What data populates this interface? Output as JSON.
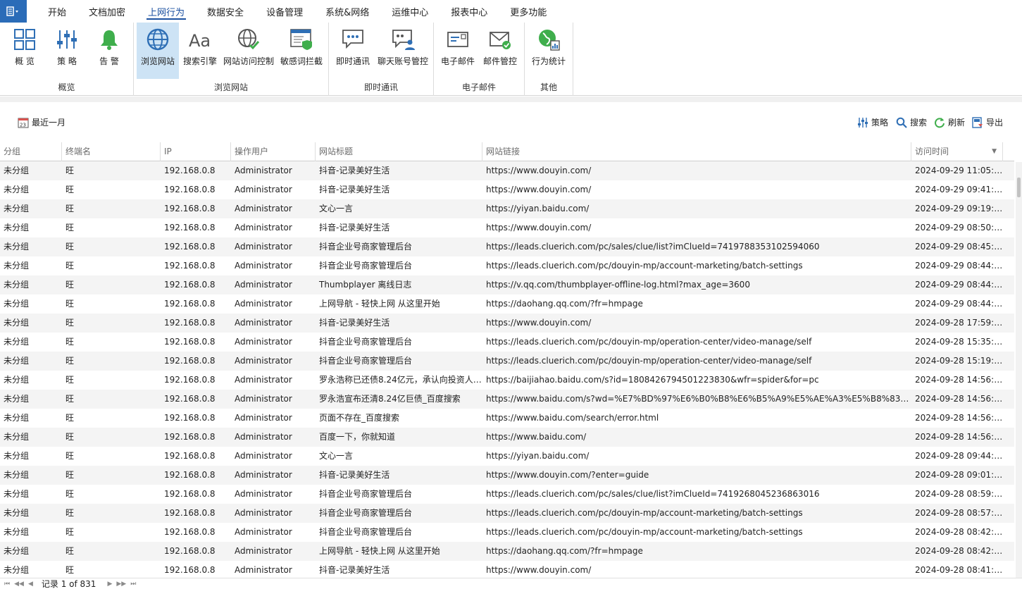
{
  "menu": {
    "tabs": [
      "开始",
      "文档加密",
      "上网行为",
      "数据安全",
      "设备管理",
      "系统&网络",
      "运维中心",
      "报表中心",
      "更多功能"
    ],
    "active_index": 2
  },
  "ribbon": {
    "groups": {
      "overview": "概览",
      "browse": "浏览网站",
      "im": "即时通讯",
      "email": "电子邮件",
      "other": "其他"
    },
    "buttons": {
      "overview": "概 览",
      "policy": "策 略",
      "alert": "告 警",
      "browse_web": "浏览网站",
      "search_engine": "搜索引擎",
      "site_access": "网站访问控制",
      "sensitive_words": "敏感词拦截",
      "im": "即时通讯",
      "chat_accounts": "聊天账号管控",
      "email": "电子邮件",
      "email_control": "邮件管控",
      "stats": "行为统计"
    }
  },
  "toolbar": {
    "date_filter": "最近一月",
    "date_icon_text": "23",
    "policy": "策略",
    "search": "搜索",
    "refresh": "刷新",
    "export": "导出"
  },
  "table": {
    "columns": [
      "分组",
      "终端名",
      "IP",
      "操作用户",
      "网站标题",
      "网站链接",
      "访问时间"
    ],
    "sort_indicator": "▼",
    "rows": [
      [
        "未分组",
        "旺",
        "192.168.0.8",
        "Administrator",
        "抖音-记录美好生活",
        "https://www.douyin.com/",
        "2024-09-29 11:05:55"
      ],
      [
        "未分组",
        "旺",
        "192.168.0.8",
        "Administrator",
        "抖音-记录美好生活",
        "https://www.douyin.com/",
        "2024-09-29 09:41:09"
      ],
      [
        "未分组",
        "旺",
        "192.168.0.8",
        "Administrator",
        "文心一言",
        "https://yiyan.baidu.com/",
        "2024-09-29 09:19:07"
      ],
      [
        "未分组",
        "旺",
        "192.168.0.8",
        "Administrator",
        "抖音-记录美好生活",
        "https://www.douyin.com/",
        "2024-09-29 08:50:47"
      ],
      [
        "未分组",
        "旺",
        "192.168.0.8",
        "Administrator",
        "抖音企业号商家管理后台",
        "https://leads.cluerich.com/pc/sales/clue/list?imClueId=7419788353102594060",
        "2024-09-29 08:45:02"
      ],
      [
        "未分组",
        "旺",
        "192.168.0.8",
        "Administrator",
        "抖音企业号商家管理后台",
        "https://leads.cluerich.com/pc/douyin-mp/account-marketing/batch-settings",
        "2024-09-29 08:44:47"
      ],
      [
        "未分组",
        "旺",
        "192.168.0.8",
        "Administrator",
        "Thumbplayer 离线日志",
        "https://v.qq.com/thumbplayer-offline-log.html?max_age=3600",
        "2024-09-29 08:44:42"
      ],
      [
        "未分组",
        "旺",
        "192.168.0.8",
        "Administrator",
        "上网导航 - 轻快上网 从这里开始",
        "https://daohang.qq.com/?fr=hmpage",
        "2024-09-29 08:44:39"
      ],
      [
        "未分组",
        "旺",
        "192.168.0.8",
        "Administrator",
        "抖音-记录美好生活",
        "https://www.douyin.com/",
        "2024-09-28 17:59:28"
      ],
      [
        "未分组",
        "旺",
        "192.168.0.8",
        "Administrator",
        "抖音企业号商家管理后台",
        "https://leads.cluerich.com/pc/douyin-mp/operation-center/video-manage/self",
        "2024-09-28 15:35:09"
      ],
      [
        "未分组",
        "旺",
        "192.168.0.8",
        "Administrator",
        "抖音企业号商家管理后台",
        "https://leads.cluerich.com/pc/douyin-mp/operation-center/video-manage/self",
        "2024-09-28 15:19:15"
      ],
      [
        "未分组",
        "旺",
        "192.168.0.8",
        "Administrator",
        "罗永浩称已还债8.24亿元，承认向投资人…",
        "https://baijiahao.baidu.com/s?id=1808426794501223830&wfr=spider&for=pc",
        "2024-09-28 14:56:33"
      ],
      [
        "未分组",
        "旺",
        "192.168.0.8",
        "Administrator",
        "罗永浩宣布还清8.24亿巨债_百度搜索",
        "https://www.baidu.com/s?wd=%E7%BD%97%E6%B0%B8%E6%B5%A9%E5%AE%A3%E5%B8%83%E8…",
        "2024-09-28 14:56:13"
      ],
      [
        "未分组",
        "旺",
        "192.168.0.8",
        "Administrator",
        "页面不存在_百度搜索",
        "https://www.baidu.com/search/error.html",
        "2024-09-28 14:56:10"
      ],
      [
        "未分组",
        "旺",
        "192.168.0.8",
        "Administrator",
        "百度一下，你就知道",
        "https://www.baidu.com/",
        "2024-09-28 14:56:09"
      ],
      [
        "未分组",
        "旺",
        "192.168.0.8",
        "Administrator",
        "文心一言",
        "https://yiyan.baidu.com/",
        "2024-09-28 09:44:42"
      ],
      [
        "未分组",
        "旺",
        "192.168.0.8",
        "Administrator",
        "抖音-记录美好生活",
        "https://www.douyin.com/?enter=guide",
        "2024-09-28 09:01:45"
      ],
      [
        "未分组",
        "旺",
        "192.168.0.8",
        "Administrator",
        "抖音企业号商家管理后台",
        "https://leads.cluerich.com/pc/sales/clue/list?imClueId=7419268045236863016",
        "2024-09-28 08:59:15"
      ],
      [
        "未分组",
        "旺",
        "192.168.0.8",
        "Administrator",
        "抖音企业号商家管理后台",
        "https://leads.cluerich.com/pc/douyin-mp/account-marketing/batch-settings",
        "2024-09-28 08:57:05"
      ],
      [
        "未分组",
        "旺",
        "192.168.0.8",
        "Administrator",
        "抖音企业号商家管理后台",
        "https://leads.cluerich.com/pc/douyin-mp/account-marketing/batch-settings",
        "2024-09-28 08:42:15"
      ],
      [
        "未分组",
        "旺",
        "192.168.0.8",
        "Administrator",
        "上网导航 - 轻快上网 从这里开始",
        "https://daohang.qq.com/?fr=hmpage",
        "2024-09-28 08:42:14"
      ],
      [
        "未分组",
        "旺",
        "192.168.0.8",
        "Administrator",
        "抖音-记录美好生活",
        "https://www.douyin.com/",
        "2024-09-28 08:41:18"
      ]
    ]
  },
  "footer": {
    "records": "记录 1 of 831",
    "nav_first": "⏮",
    "nav_prev_page": "◀◀",
    "nav_prev": "◀",
    "nav_next": "▶",
    "nav_next_page": "▶▶",
    "nav_last": "⏭"
  },
  "colors": {
    "accent": "#1a4fa0",
    "app_button": "#2b6cb8",
    "active_ribbon": "#cde3f5",
    "row_alt": "#f4f4f4"
  }
}
